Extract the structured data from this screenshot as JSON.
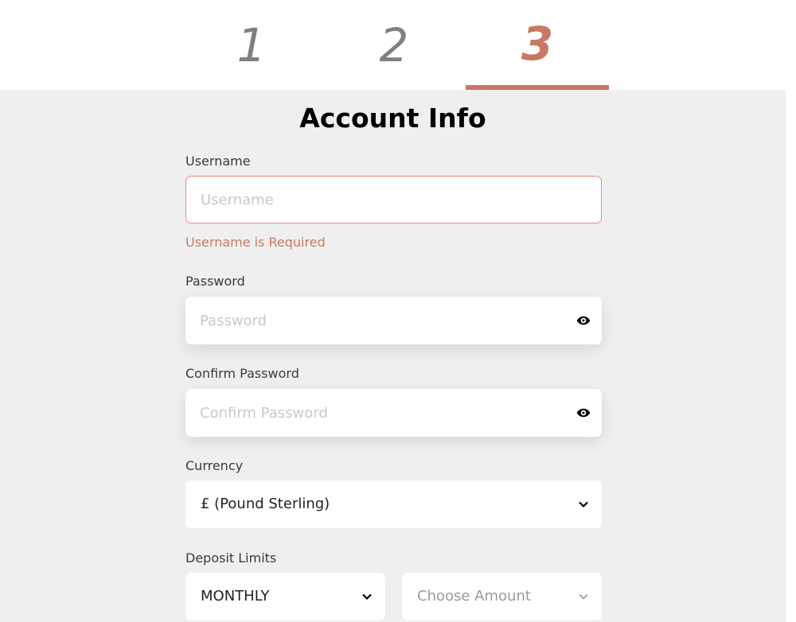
{
  "stepper": {
    "steps": [
      {
        "label": "1",
        "active": false
      },
      {
        "label": "2",
        "active": false
      },
      {
        "label": "3",
        "active": true
      }
    ],
    "active_color": "#c87963",
    "inactive_color": "#808080"
  },
  "form": {
    "title": "Account Info",
    "username": {
      "label": "Username",
      "placeholder": "Username",
      "value": "",
      "error": "Username is Required"
    },
    "password": {
      "label": "Password",
      "placeholder": "Password",
      "value": "",
      "toggle_icon": "eye-icon"
    },
    "confirm_password": {
      "label": "Confirm Password",
      "placeholder": "Confirm Password",
      "value": "",
      "toggle_icon": "eye-icon"
    },
    "currency": {
      "label": "Currency",
      "selected": "£ (Pound Sterling)",
      "icon": "chevron-down-icon"
    },
    "deposit_limits": {
      "label": "Deposit Limits",
      "period_selected": "MONTHLY",
      "amount_placeholder": "Choose Amount",
      "icon": "chevron-down-icon"
    }
  },
  "colors": {
    "accent": "#c87963",
    "error_border": "#f08a85",
    "background": "#efefef"
  }
}
